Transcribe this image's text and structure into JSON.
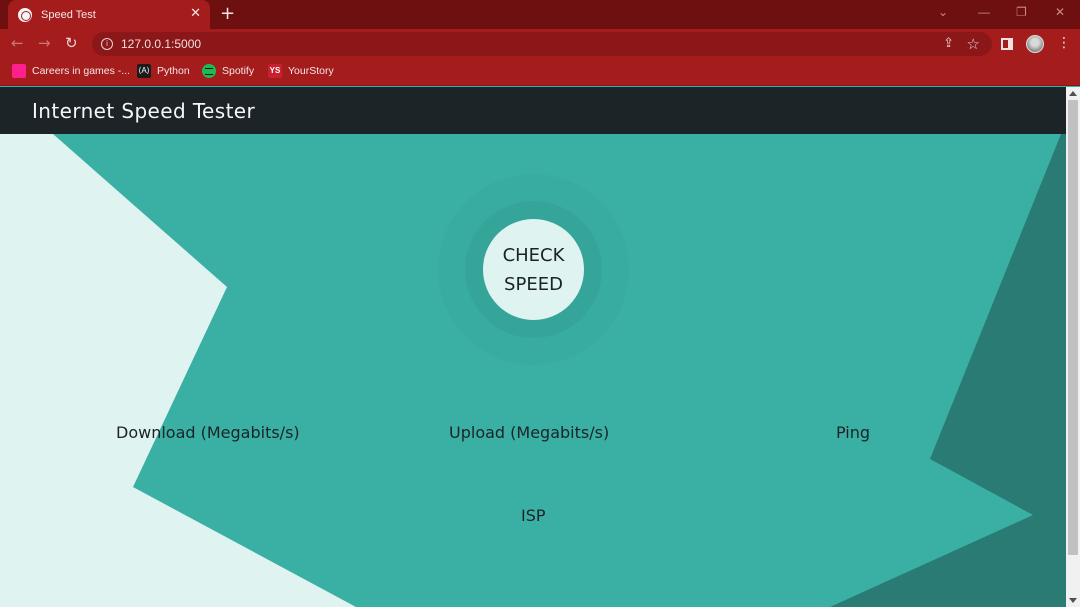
{
  "browser": {
    "tab_title": "Speed Test",
    "tab_close": "✕",
    "new_tab": "+",
    "url": "127.0.0.1:5000",
    "bookmarks": [
      {
        "label": "Careers in games -...",
        "icon": "careers-icon"
      },
      {
        "label": "Python",
        "icon": "python-icon",
        "icon_text": "⟨A⟩"
      },
      {
        "label": "Spotify",
        "icon": "spotify-icon"
      },
      {
        "label": "YourStory",
        "icon": "yourstory-icon",
        "icon_text": "YS"
      }
    ],
    "colors": {
      "tabbar": "#6e0f10",
      "toolbar": "#a51c1d"
    }
  },
  "app": {
    "title": "Internet Speed Tester",
    "check_button": [
      "CHECK",
      "SPEED"
    ],
    "stats": {
      "download": "Download (Megabits/s)",
      "upload": "Upload (Megabits/s)",
      "ping": "Ping",
      "isp": "ISP"
    },
    "colors": {
      "navbar": "#1c2428",
      "teal": "#3ab0a5",
      "light": "#dff3f1",
      "dark_teal": "#2a7b74"
    }
  }
}
